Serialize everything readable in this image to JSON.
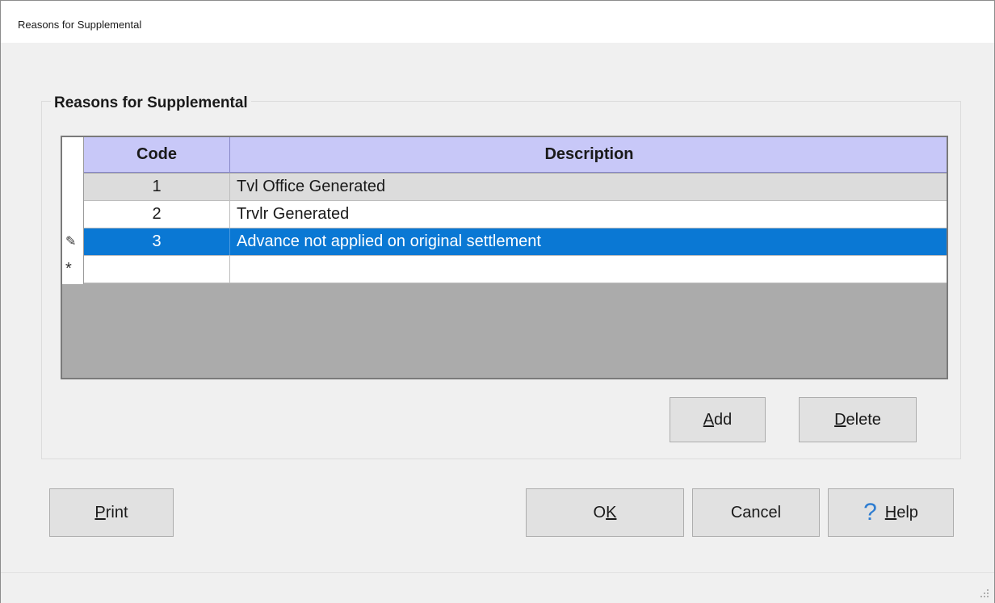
{
  "window": {
    "title": "Reasons for Supplemental"
  },
  "group": {
    "label": "Reasons for Supplemental"
  },
  "grid": {
    "columns": [
      "Code",
      "Description"
    ],
    "rows": [
      {
        "code": "1",
        "description": "Tvl Office Generated"
      },
      {
        "code": "2",
        "description": "Trvlr Generated"
      },
      {
        "code": "3",
        "description": "Advance not applied on original settlement"
      }
    ],
    "edit_indicator": "✎",
    "new_row_indicator": "*"
  },
  "buttons": {
    "add": {
      "mnemonic": "A",
      "rest": "dd"
    },
    "delete": {
      "mnemonic": "D",
      "rest": "elete"
    },
    "print": {
      "mnemonic": "P",
      "rest": "rint"
    },
    "ok": {
      "pre": "O",
      "mnemonic": "K"
    },
    "cancel": "Cancel",
    "help": {
      "icon": "?",
      "mnemonic": "H",
      "rest": "elp"
    }
  },
  "colors": {
    "selection": "#0a78d4",
    "header": "#c8c8f8",
    "help_icon": "#2e7dd1"
  }
}
